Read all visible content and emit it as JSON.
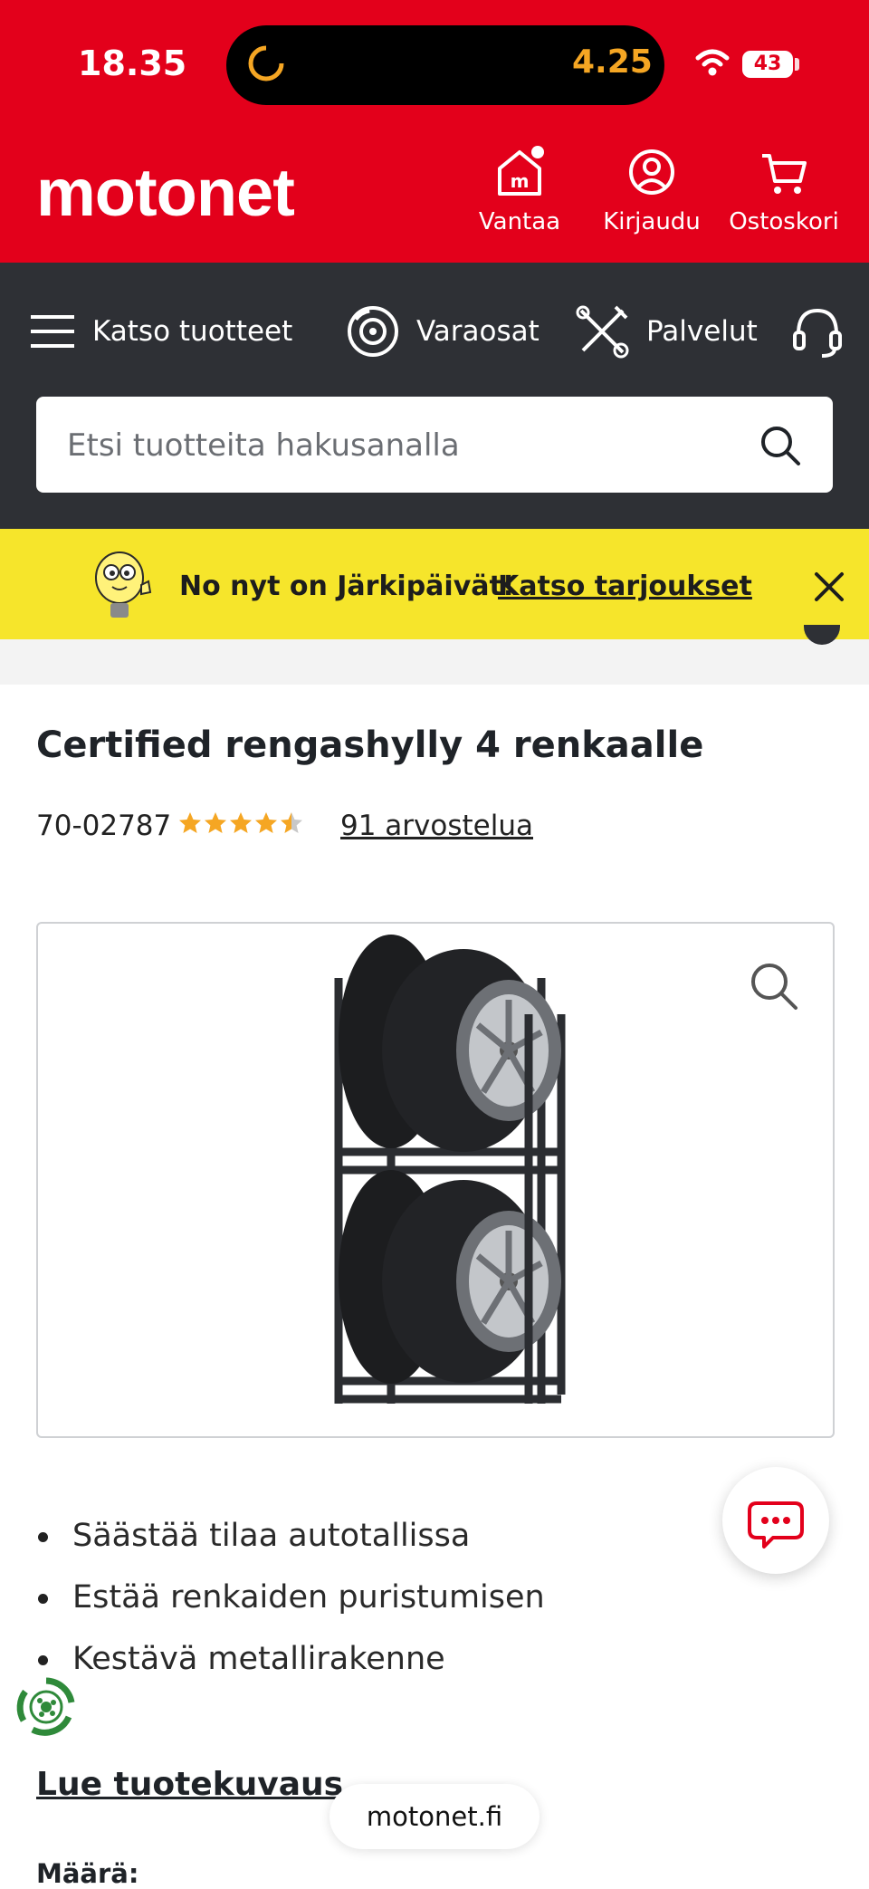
{
  "status_bar": {
    "time": "18.35",
    "island_time": "4.25",
    "battery": "43"
  },
  "header": {
    "logo": "motonet",
    "store_label": "Vantaa",
    "login_label": "Kirjaudu",
    "cart_label": "Ostoskori"
  },
  "nav": {
    "products_label": "Katso tuotteet",
    "parts_label": "Varaosat",
    "services_label": "Palvelut"
  },
  "search": {
    "placeholder": "Etsi tuotteita hakusanalla"
  },
  "banner": {
    "text": "No nyt on Järkipäivät!",
    "link": "Katso tarjoukset"
  },
  "product": {
    "title": "Certified rengashylly 4 renkaalle",
    "sku": "70-02787",
    "rating": 4.5,
    "rating_max": 5,
    "reviews_label": "91 arvostelua",
    "features": [
      "Säästää tilaa autotallissa",
      "Estää renkaiden puristumisen",
      "Kestävä metallirakenne"
    ],
    "read_more": "Lue tuotekuvaus",
    "quantity_label": "Määrä:"
  },
  "browser": {
    "url": "motonet.fi"
  },
  "colors": {
    "brand_red": "#e3001b",
    "nav_dark": "#2e3035",
    "banner_yellow": "#f6e52b",
    "star": "#f5a623"
  }
}
